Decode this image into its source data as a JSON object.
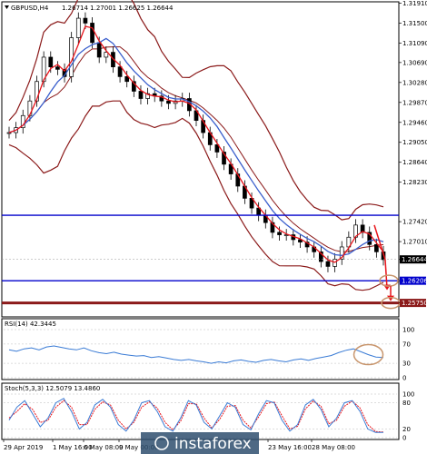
{
  "header": {
    "symbol": "GBPUSD,H4",
    "ohlc": "1.26714 1.27001 1.26625 1.26644"
  },
  "watermark": "instaforex",
  "colors": {
    "candle_up": "#000000",
    "candle_down": "#000000",
    "bollinger": "#8b1a1a",
    "ma_fast": "#e8141b",
    "ma_slow": "#3a5fcd",
    "hline_blue": "#0000cc",
    "hline_red": "#8b1a1a",
    "arrow": "#e8141b",
    "circle": "#c8956c",
    "rsi": "#3a7bd5",
    "stoch_main": "#3a7bd5",
    "stoch_signal": "#e8141b"
  },
  "chart_data": [
    {
      "type": "candlestick",
      "title": "GBPUSD,H4",
      "ylim": [
        1.255,
        1.319
      ],
      "y_ticks": [
        "1.31910",
        "1.31500",
        "1.31090",
        "1.30690",
        "1.30280",
        "1.29870",
        "1.29460",
        "1.29050",
        "1.28640",
        "1.28230",
        "1.27420",
        "1.27010",
        "1.26644",
        "1.26206",
        "1.25750"
      ],
      "price_label": "1.26644",
      "levels": [
        {
          "value": 1.27551,
          "label": "1.27551",
          "color": "#0000cc"
        },
        {
          "value": 1.26206,
          "label": "1.26206",
          "color": "#0000cc"
        },
        {
          "value": 1.2575,
          "label": "1.25750",
          "color": "#8b1a1a"
        }
      ],
      "x_labels": [
        "29 Apr 2019",
        "1 May 16:00",
        "6 May 08:00",
        "9 May 00:00",
        "23 May 16:00",
        "28 May 08:00"
      ],
      "close_path": [
        1.2925,
        1.2935,
        1.296,
        1.299,
        1.303,
        1.308,
        1.306,
        1.3055,
        1.304,
        1.312,
        1.316,
        1.315,
        1.311,
        1.308,
        1.309,
        1.306,
        1.304,
        1.303,
        1.301,
        1.2995,
        1.3005,
        1.3,
        1.299,
        1.2985,
        1.299,
        1.2995,
        1.297,
        1.295,
        1.2925,
        1.29,
        1.2885,
        1.286,
        1.284,
        1.2815,
        1.279,
        1.277,
        1.2755,
        1.274,
        1.272,
        1.2715,
        1.2715,
        1.2705,
        1.27,
        1.269,
        1.268,
        1.266,
        1.265,
        1.2665,
        1.269,
        1.271,
        1.2735,
        1.272,
        1.2695,
        1.268,
        1.2664
      ]
    },
    {
      "type": "line",
      "title": "RSI(14) 42.3445",
      "ylim": [
        0,
        100
      ],
      "y_ticks": [
        "100",
        "70",
        "30",
        "0"
      ],
      "values": [
        58,
        55,
        60,
        62,
        58,
        64,
        66,
        63,
        60,
        58,
        62,
        56,
        52,
        50,
        53,
        49,
        47,
        45,
        46,
        42,
        44,
        41,
        38,
        36,
        38,
        35,
        33,
        30,
        33,
        31,
        35,
        37,
        34,
        32,
        36,
        38,
        35,
        33,
        37,
        39,
        36,
        40,
        43,
        46,
        52,
        57,
        60,
        54,
        48,
        43,
        42
      ]
    },
    {
      "type": "line",
      "title": "Stoch(5,3,3) 12.5079 13.4860",
      "ylim": [
        0,
        100
      ],
      "y_ticks": [
        "100",
        "80",
        "20",
        "0"
      ],
      "series": [
        {
          "values": [
            40,
            70,
            85,
            55,
            25,
            45,
            80,
            90,
            60,
            20,
            35,
            75,
            88,
            70,
            30,
            15,
            40,
            80,
            85,
            60,
            25,
            15,
            45,
            85,
            75,
            35,
            20,
            50,
            80,
            70,
            30,
            18,
            55,
            85,
            80,
            40,
            15,
            30,
            75,
            88,
            65,
            25,
            45,
            80,
            85,
            60,
            20,
            12,
            12
          ]
        },
        {
          "values": [
            45,
            60,
            78,
            65,
            35,
            40,
            70,
            85,
            70,
            30,
            30,
            65,
            82,
            75,
            40,
            20,
            35,
            70,
            82,
            68,
            35,
            18,
            38,
            78,
            78,
            45,
            22,
            42,
            72,
            74,
            40,
            22,
            48,
            78,
            82,
            50,
            20,
            26,
            66,
            84,
            72,
            32,
            40,
            72,
            84,
            68,
            30,
            14,
            13
          ]
        }
      ]
    }
  ]
}
